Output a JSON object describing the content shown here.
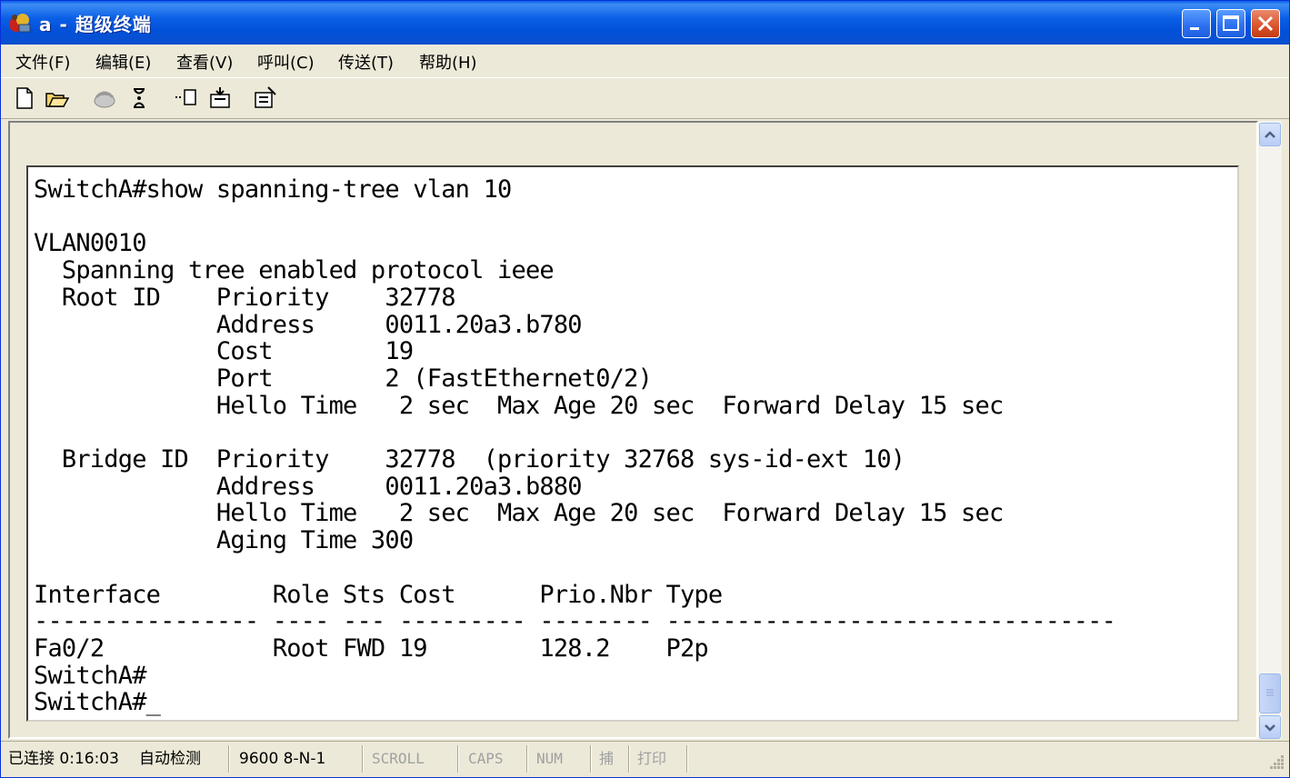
{
  "window": {
    "title": "a - 超级终端",
    "minimize_icon": "minimize-icon",
    "maximize_icon": "maximize-icon",
    "close_icon": "close-icon"
  },
  "menu": [
    "文件(F)",
    "编辑(E)",
    "查看(V)",
    "呼叫(C)",
    "传送(T)",
    "帮助(H)"
  ],
  "toolbar": [
    "new-icon",
    "open-icon",
    "phone-icon",
    "disconnect-icon",
    "send-icon",
    "receive-icon",
    "properties-icon"
  ],
  "terminal": {
    "lines": [
      "SwitchA#show spanning-tree vlan 10",
      "",
      "VLAN0010",
      "  Spanning tree enabled protocol ieee",
      "  Root ID    Priority    32778",
      "             Address     0011.20a3.b780",
      "             Cost        19",
      "             Port        2 (FastEthernet0/2)",
      "             Hello Time   2 sec  Max Age 20 sec  Forward Delay 15 sec",
      "",
      "  Bridge ID  Priority    32778  (priority 32768 sys-id-ext 10)",
      "             Address     0011.20a3.b880",
      "             Hello Time   2 sec  Max Age 20 sec  Forward Delay 15 sec",
      "             Aging Time 300",
      "",
      "Interface        Role Sts Cost      Prio.Nbr Type",
      "---------------- ---- --- --------- -------- --------------------------------",
      "Fa0/2            Root FWD 19        128.2    P2p",
      "SwitchA#",
      "SwitchA#_"
    ]
  },
  "statusbar": {
    "connected": "已连接 0:16:03",
    "detect": "自动检测",
    "port_settings": "9600 8-N-1",
    "scroll": "SCROLL",
    "caps": "CAPS",
    "num": "NUM",
    "capture": "捕",
    "print": "打印"
  }
}
